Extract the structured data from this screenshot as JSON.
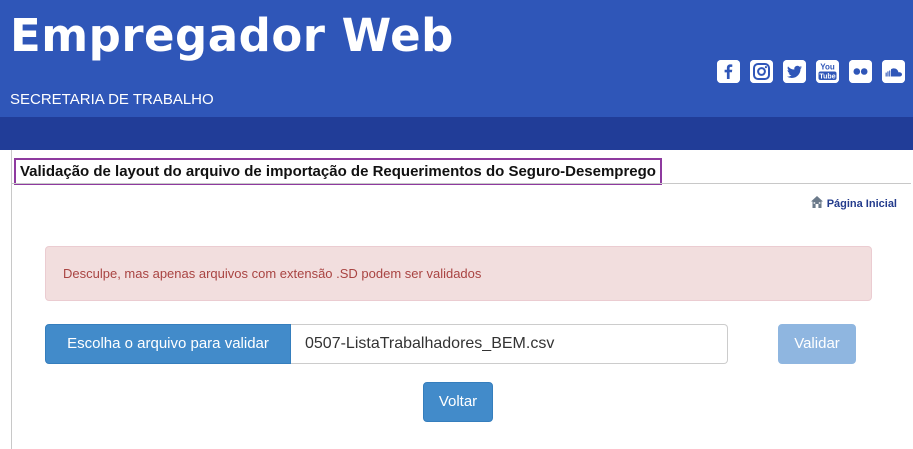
{
  "header": {
    "title": "Empregador Web",
    "subtitle": "SECRETARIA DE TRABALHO",
    "social_icons": [
      "facebook-icon",
      "instagram-icon",
      "twitter-icon",
      "youtube-icon",
      "flickr-icon",
      "soundcloud-icon"
    ],
    "youtube_label_top": "You",
    "youtube_label_bottom": "Tube"
  },
  "page": {
    "title": "Validação de layout do arquivo de importação de Requerimentos do Seguro-Desemprego",
    "home_link": "Página Inicial"
  },
  "alert": {
    "message": "Desculpe, mas apenas arquivos com extensão .SD podem ser validados"
  },
  "form": {
    "choose_label": "Escolha o arquivo para validar",
    "file_name": "0507-ListaTrabalhadores_BEM.csv",
    "validate_label": "Validar",
    "back_label": "Voltar"
  },
  "colors": {
    "header_bg": "#2f56b8",
    "subbar_bg": "#213d98",
    "primary": "#428bca",
    "primary_disabled": "#8fb6e0",
    "alert_bg": "#f2dede",
    "alert_text": "#a94442",
    "title_border": "#8e3a9f"
  }
}
